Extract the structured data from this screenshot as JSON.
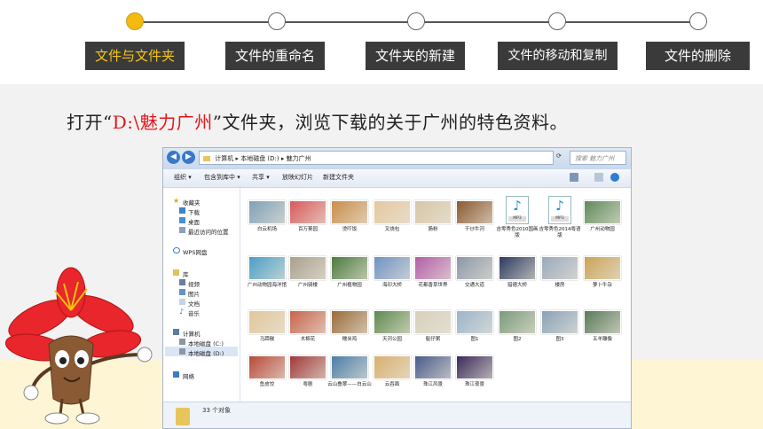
{
  "steps": [
    {
      "label": "文件与文件夹",
      "active": true
    },
    {
      "label": "文件的重命名",
      "active": false
    },
    {
      "label": "文件夹的新建",
      "active": false
    },
    {
      "label": "文件的移动和复制",
      "active": false
    },
    {
      "label": "文件的删除",
      "active": false
    }
  ],
  "instruction": {
    "prefix": "打开“",
    "highlight": "D:\\魅力广州",
    "suffix": "”文件夹，浏览下载的关于广州的特色资料。"
  },
  "colors": {
    "highlight": "#e4161c",
    "active_step": "#f5c518",
    "step_bg": "#3a3a3a",
    "active_dot": "#f5b90f"
  },
  "explorer": {
    "path": [
      "计算机",
      "本地磁盘 (D:)",
      "魅力广州"
    ],
    "search_placeholder": "搜索 魅力广州",
    "toolbar": [
      "组织 ▾",
      "包含到库中 ▾",
      "共享 ▾",
      "放映幻灯片",
      "新建文件夹"
    ],
    "nav": {
      "favorites": "收藏夹",
      "favorites_items": [
        "下载",
        "桌面",
        "最近访问的位置"
      ],
      "wps": "WPS网盘",
      "libraries": "库",
      "library_items": [
        "视频",
        "图片",
        "文档",
        "音乐"
      ],
      "computer": "计算机",
      "drives": [
        "本地磁盘 (C:)",
        "本地磁盘 (D:)"
      ],
      "network": "网络"
    },
    "files": [
      {
        "name": "白云机场",
        "type": "image",
        "color": "#7fa0b8"
      },
      {
        "name": "百万葵园",
        "type": "image",
        "color": "#d85a5a"
      },
      {
        "name": "烫吓饭",
        "type": "image",
        "color": "#c98d4a"
      },
      {
        "name": "叉烧包",
        "type": "image",
        "color": "#e4c8a0"
      },
      {
        "name": "肠粉",
        "type": "image",
        "color": "#d8c6a6"
      },
      {
        "name": "干炒牛河",
        "type": "image",
        "color": "#8a5a30"
      },
      {
        "name": "吉零秀色2010国画版",
        "type": "mp3",
        "color": ""
      },
      {
        "name": "吉零秀色2014粤语版",
        "type": "mp3",
        "color": ""
      },
      {
        "name": "广州动物园",
        "type": "image",
        "color": "#5f8a5a"
      },
      {
        "name": "广州动物园海洋馆",
        "type": "image",
        "color": "#4a9ec8"
      },
      {
        "name": "广州骑楼",
        "type": "image",
        "color": "#a9a08e"
      },
      {
        "name": "广州植物园",
        "type": "image",
        "color": "#4c7a3e"
      },
      {
        "name": "海印大桥",
        "type": "image",
        "color": "#6f92c4"
      },
      {
        "name": "花都香草世界",
        "type": "image",
        "color": "#b25fa8"
      },
      {
        "name": "交通大道",
        "type": "image",
        "color": "#8b97a8"
      },
      {
        "name": "猎德大桥",
        "type": "image",
        "color": "#2b3a5e"
      },
      {
        "name": "楼房",
        "type": "image",
        "color": "#9aa9bb"
      },
      {
        "name": "萝卜牛杂",
        "type": "image",
        "color": "#caa458"
      },
      {
        "name": "马蹄糕",
        "type": "image",
        "color": "#e2c79a"
      },
      {
        "name": "木棉花",
        "type": "image",
        "color": "#c8644a"
      },
      {
        "name": "糯米鸡",
        "type": "image",
        "color": "#9a6a3a"
      },
      {
        "name": "天河公园",
        "type": "image",
        "color": "#5e8a4e"
      },
      {
        "name": "艇仔粥",
        "type": "image",
        "color": "#d8d0bc"
      },
      {
        "name": "图1",
        "type": "image",
        "color": "#9ab4cc"
      },
      {
        "name": "图2",
        "type": "image",
        "color": "#7b9a7a"
      },
      {
        "name": "图3",
        "type": "image",
        "color": "#8aa2b8"
      },
      {
        "name": "五羊雕像",
        "type": "image",
        "color": "#5a7a5a"
      },
      {
        "name": "鱼皮饺",
        "type": "image",
        "color": "#b84a3a"
      },
      {
        "name": "粤剧",
        "type": "image",
        "color": "#a03a3a"
      },
      {
        "name": "云山叠翠——白云山",
        "type": "image",
        "color": "#4c7ea8"
      },
      {
        "name": "云吞面",
        "type": "image",
        "color": "#d8b070"
      },
      {
        "name": "珠江风景",
        "type": "image",
        "color": "#4a5a8a"
      },
      {
        "name": "珠江夜景",
        "type": "image",
        "color": "#3a2a5a"
      }
    ],
    "status": "33 个对象"
  }
}
